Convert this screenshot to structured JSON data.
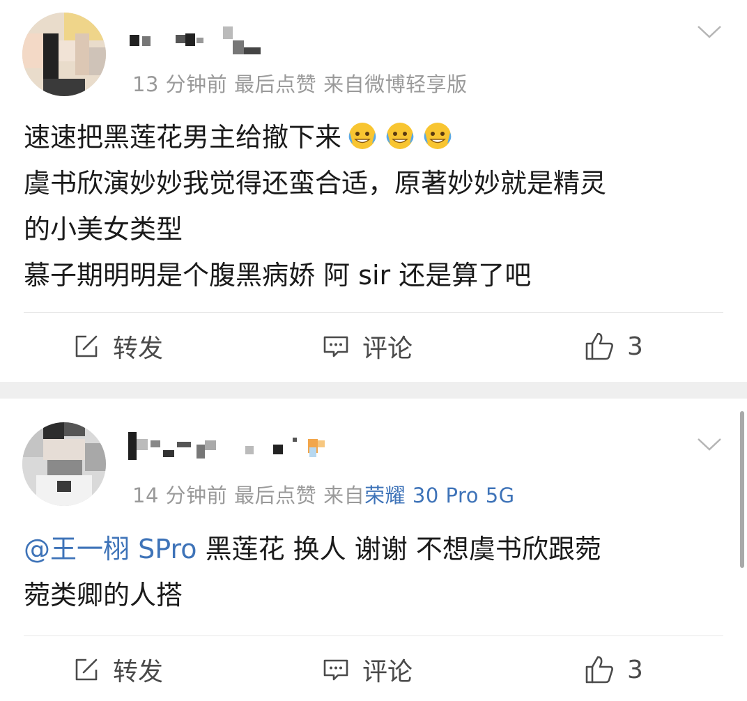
{
  "posts": [
    {
      "meta": {
        "time": "13 分钟前",
        "liked": "最后点赞",
        "source_prefix": "来自微博轻享版",
        "source_link": ""
      },
      "content": {
        "line1": "速速把黑莲花男主给撤下来",
        "line2": "虞书欣演妙妙我觉得还蛮合适，原著妙妙就是精灵",
        "line3": "的小美女类型",
        "line4": "慕子期明明是个腹黑病娇 阿 sir 还是算了吧"
      },
      "emojis": [
        "grin-sweat-emoji",
        "grin-sweat-emoji",
        "grin-sweat-emoji"
      ],
      "actions": {
        "repost": "转发",
        "comment": "评论",
        "like_count": "3"
      }
    },
    {
      "meta": {
        "time": "14 分钟前",
        "liked": "最后点赞",
        "source_prefix": "来自",
        "source_link": "荣耀 30 Pro 5G"
      },
      "content": {
        "mention": "@王一栩 SPro",
        "line1_rest": " 黑莲花 换人 谢谢 不想虞书欣跟菀",
        "line2": "菀类卿的人搭"
      },
      "actions": {
        "repost": "转发",
        "comment": "评论",
        "like_count": "3"
      }
    }
  ],
  "colors": {
    "link": "#3e73b8",
    "meta": "#9a9a9a",
    "separator": "#efefef"
  },
  "icons": [
    "repost-icon",
    "comment-icon",
    "like-icon",
    "chevron-down-icon"
  ]
}
